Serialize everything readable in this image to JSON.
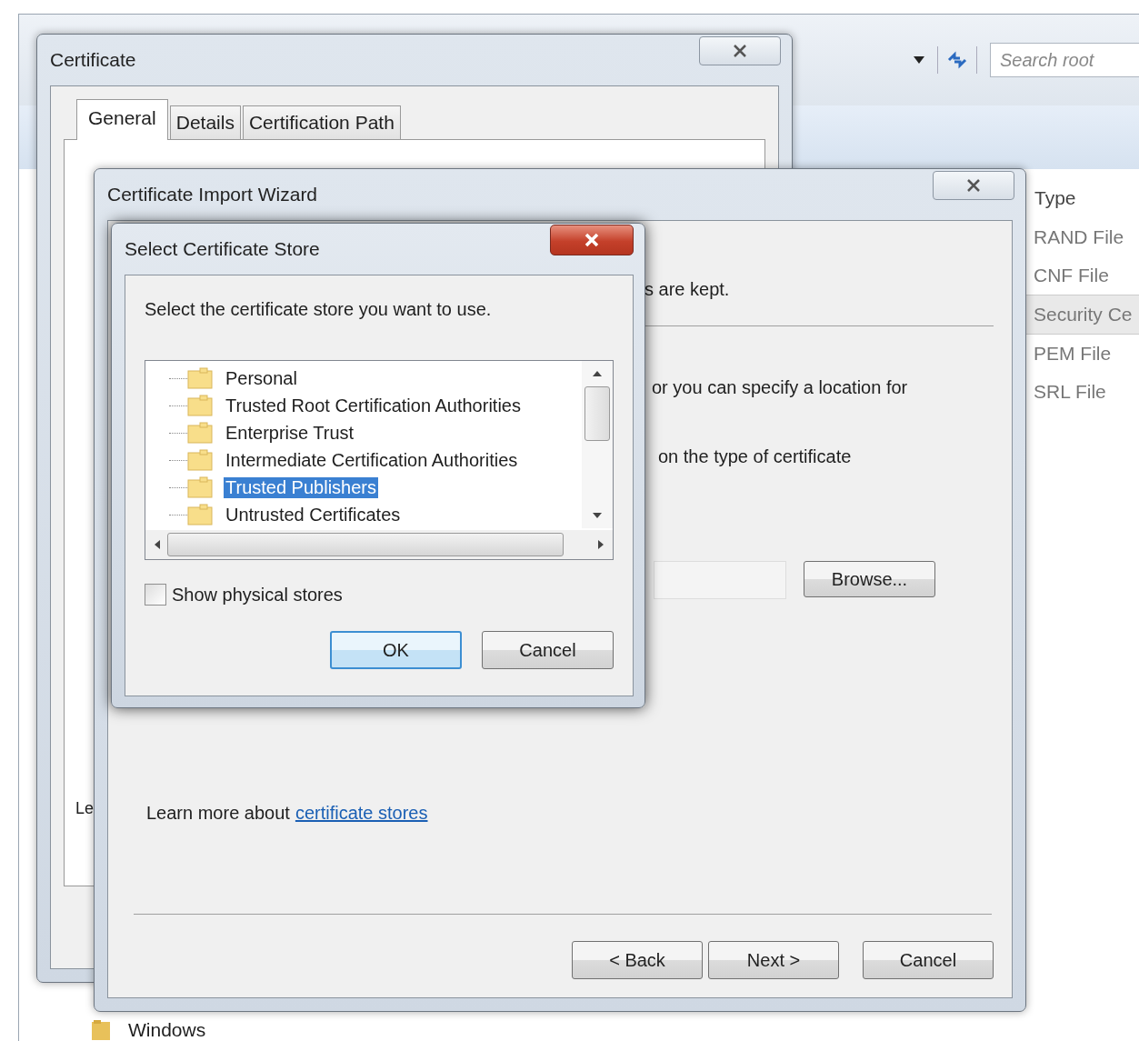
{
  "explorer": {
    "search": {
      "placeholder": "Search root"
    },
    "columns": [
      "Type"
    ],
    "rows": [
      {
        "type": "RAND File",
        "selected": false
      },
      {
        "type": "CNF File",
        "selected": false
      },
      {
        "type": "Security Ce",
        "selected": true
      },
      {
        "type": "PEM File",
        "selected": false
      },
      {
        "type": "SRL File",
        "selected": false
      }
    ],
    "folders": [
      "Windows"
    ]
  },
  "certificate_dialog": {
    "title": "Certificate",
    "tabs": [
      {
        "label": "General",
        "selected": true
      },
      {
        "label": "Details",
        "selected": false
      },
      {
        "label": "Certification Path",
        "selected": false
      }
    ],
    "cut_text": "Le"
  },
  "import_wizard": {
    "title": "Certificate Import Wizard",
    "texts": [
      "s are kept.",
      "or you can specify a location for",
      "on the type of certificate"
    ],
    "browse_button": "Browse...",
    "learn_more": {
      "text": "Learn more about",
      "link": "certificate stores"
    },
    "buttons": [
      {
        "label": "< Back"
      },
      {
        "label": "Next >"
      },
      {
        "label": "Cancel"
      }
    ]
  },
  "store_dialog": {
    "title": "Select Certificate Store",
    "prompt": "Select the certificate store you want to use.",
    "stores": [
      {
        "label": "Personal",
        "selected": false
      },
      {
        "label": "Trusted Root Certification Authorities",
        "selected": false
      },
      {
        "label": "Enterprise Trust",
        "selected": false
      },
      {
        "label": "Intermediate Certification Authorities",
        "selected": false
      },
      {
        "label": "Trusted Publishers",
        "selected": true
      },
      {
        "label": "Untrusted Certificates",
        "selected": false
      }
    ],
    "show_physical": {
      "label": "Show physical stores",
      "checked": false
    },
    "buttons": [
      {
        "label": "OK",
        "default": true
      },
      {
        "label": "Cancel",
        "default": false
      }
    ]
  }
}
